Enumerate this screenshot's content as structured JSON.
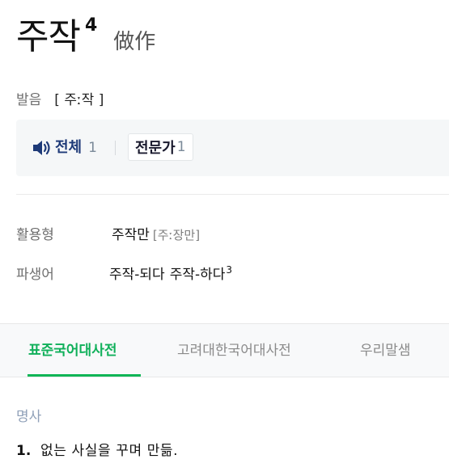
{
  "entry": {
    "headword": "주작",
    "homonym_number": "4",
    "hanja": "做作"
  },
  "pronunciation": {
    "label": "발음",
    "value": "[ 주ː작 ]"
  },
  "audio": {
    "all_label": "전체",
    "all_count": "1",
    "expert_label": "전문가",
    "expert_count": "1",
    "icon": "speaker-icon",
    "icon_color": "#1e3a78"
  },
  "inflection": {
    "label": "활용형",
    "form": "주작만",
    "pronunciation": "[주ː장만]"
  },
  "derivative": {
    "label": "파생어",
    "word1": "주작-되다",
    "word2": "주작-하다",
    "word2_homonym": "3"
  },
  "tabs": [
    {
      "label": "표준국어대사전",
      "active": true
    },
    {
      "label": "고려대한국어대사전",
      "active": false
    },
    {
      "label": "우리말샘",
      "active": false
    }
  ],
  "colors": {
    "active_tab": "#10b05a",
    "pos_label": "#8fa0b8"
  },
  "definition": {
    "pos": "명사",
    "number": "1.",
    "text": "없는 사실을 꾸며 만듦."
  }
}
